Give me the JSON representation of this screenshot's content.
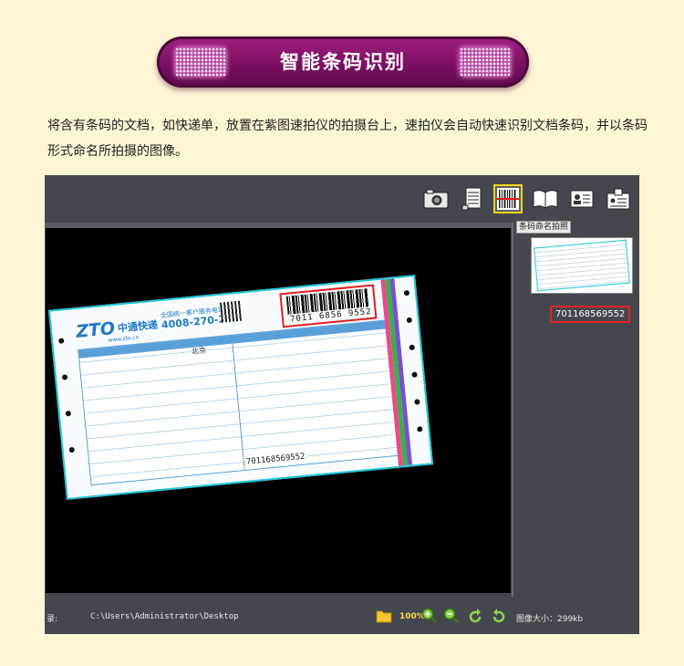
{
  "banner": {
    "title": "智能条码识别"
  },
  "description": "将含有条码的文档，如快递单，放置在紫图速拍仪的拍摄台上，速拍仪会自动快速识别文档条码，并以条码形式命名所拍摄的图像。",
  "toolbar": {
    "icons": [
      "camera-icon",
      "scanner-icon",
      "barcode-icon",
      "book-icon",
      "id-card-icon",
      "badge-icon"
    ],
    "tooltip": "条码命名拍照"
  },
  "receipt": {
    "brand_cn": "中通快递",
    "brand_logo": "ZTO",
    "hotline_label": "全国统一客户服务电话",
    "hotline": "4008-270-270",
    "website": "www.zto.cn",
    "barcode_number": "7011 6856 9552",
    "bottom_number": "701168569552",
    "city": "北京"
  },
  "thumbnail": {
    "label": "701168569552"
  },
  "status": {
    "dir_label": "录:",
    "path": "C:\\Users\\Administrator\\Desktop",
    "zoom": "100%",
    "size": "图像大小：299kb"
  }
}
